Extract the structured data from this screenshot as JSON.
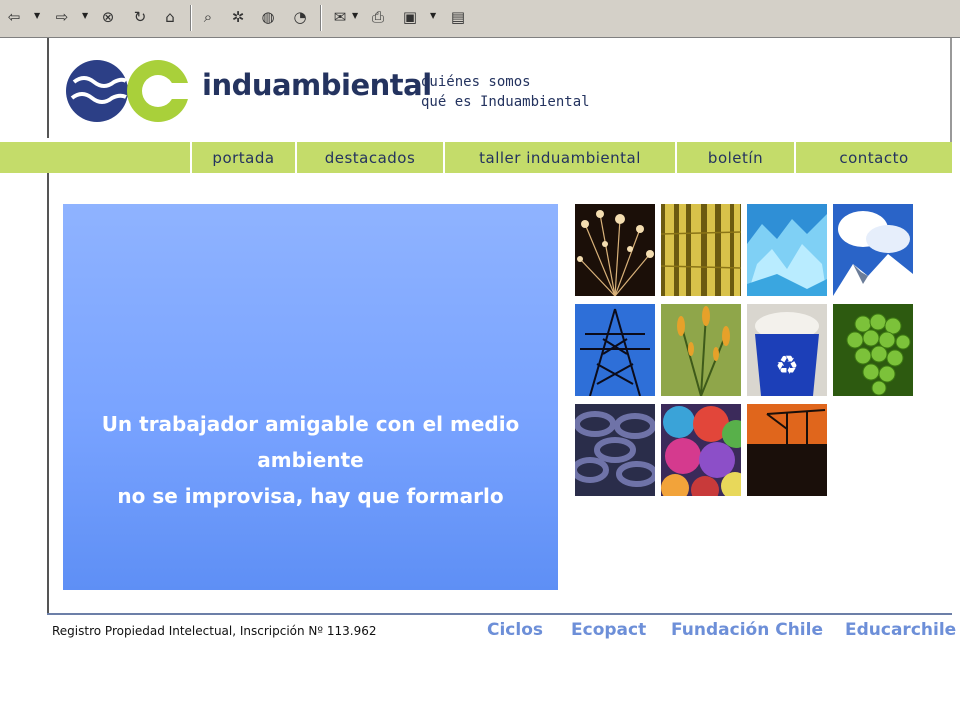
{
  "site": {
    "brand_name": "induambiental",
    "top_links": [
      "quiénes somos",
      "qué es Induambiental"
    ]
  },
  "nav": {
    "items": [
      "portada",
      "destacados",
      "taller induambiental",
      "boletín",
      "contacto"
    ]
  },
  "hero": {
    "line1": "Un trabajador amigable con el medio ambiente",
    "line2": "no se improvisa, hay que formarlo"
  },
  "gallery": {
    "images": [
      "fiber-optic-light",
      "bamboo-forest",
      "glacier-ice",
      "snowy-mountain",
      "power-tower",
      "plant-buds",
      "recycling-bin",
      "green-grapes",
      "stacked-tires",
      "yarn-balls",
      "construction-crane-sunset"
    ]
  },
  "footer": {
    "registro": "Registro Propiedad Intelectual, Inscripción Nº 113.962",
    "partners": [
      "Ciclos",
      "Ecopact",
      "Fundación Chile",
      "Educarchile"
    ]
  },
  "colors": {
    "nav_bg": "#c4dc6a",
    "brand_navy": "#24335f",
    "partner_blue": "#6d8fd8",
    "hero_blue": "#79a3ff"
  }
}
